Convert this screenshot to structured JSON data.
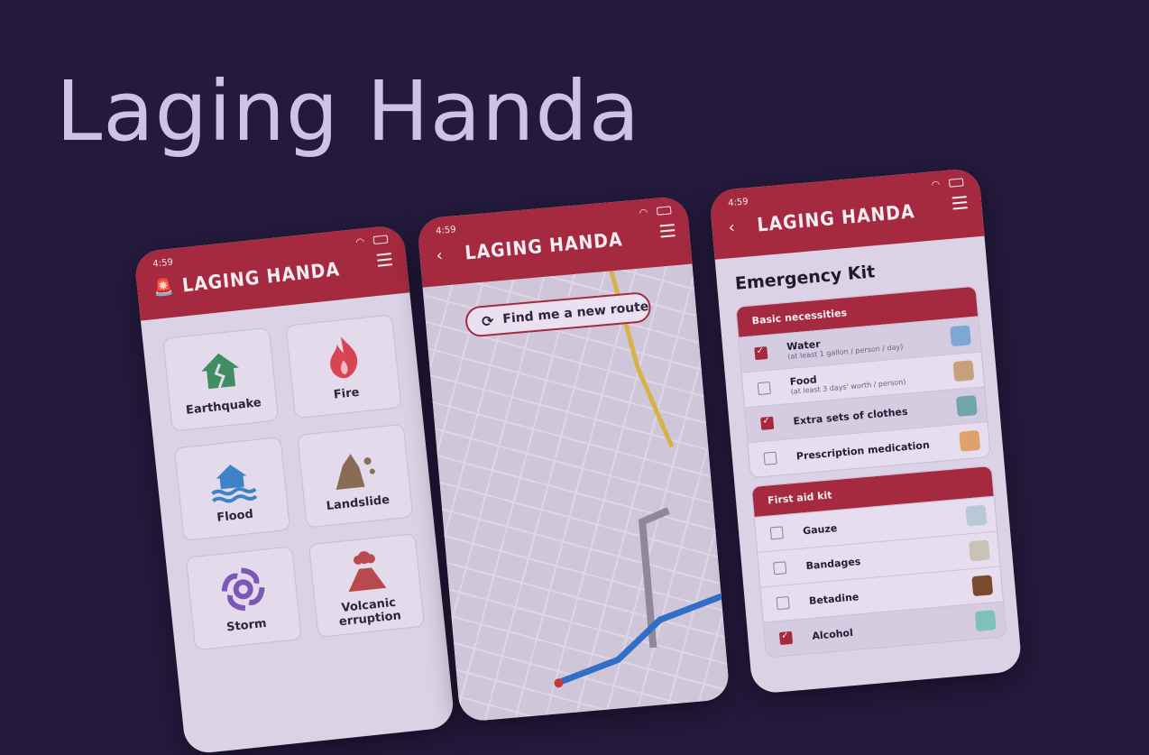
{
  "headline": "Laging Handa",
  "status": {
    "time": "4:59"
  },
  "app": {
    "name": "LAGING HANDA"
  },
  "phone1": {
    "tiles": [
      {
        "label": "Earthquake",
        "icon": "house-crack-icon",
        "color": "#3f8d60"
      },
      {
        "label": "Fire",
        "icon": "flame-icon",
        "color": "#d94453"
      },
      {
        "label": "Flood",
        "icon": "flooded-house-icon",
        "color": "#3d84c6"
      },
      {
        "label": "Landslide",
        "icon": "rockfall-icon",
        "color": "#8a6b54"
      },
      {
        "label": "Storm",
        "icon": "typhoon-icon",
        "color": "#7d57b5"
      },
      {
        "label": "Volcanic erruption",
        "icon": "volcano-icon",
        "color": "#b8494c"
      }
    ]
  },
  "phone2": {
    "route_button": "Find me a new route"
  },
  "phone3": {
    "title": "Emergency Kit",
    "sections": [
      {
        "heading": "Basic necessities",
        "items": [
          {
            "label": "Water",
            "note": "(at least 1 gallon / person / day)",
            "checked": true
          },
          {
            "label": "Food",
            "note": "(at least 3 days' worth / person)",
            "checked": false
          },
          {
            "label": "Extra sets of clothes",
            "note": "",
            "checked": true
          },
          {
            "label": "Prescription medication",
            "note": "",
            "checked": false
          }
        ]
      },
      {
        "heading": "First aid kit",
        "items": [
          {
            "label": "Gauze",
            "checked": false
          },
          {
            "label": "Bandages",
            "checked": false
          },
          {
            "label": "Betadine",
            "checked": false
          },
          {
            "label": "Alcohol",
            "checked": true
          }
        ]
      }
    ]
  },
  "colors": {
    "background": "#241a3d",
    "brand_red": "#a52a3f",
    "headline": "#cfc2e6"
  }
}
